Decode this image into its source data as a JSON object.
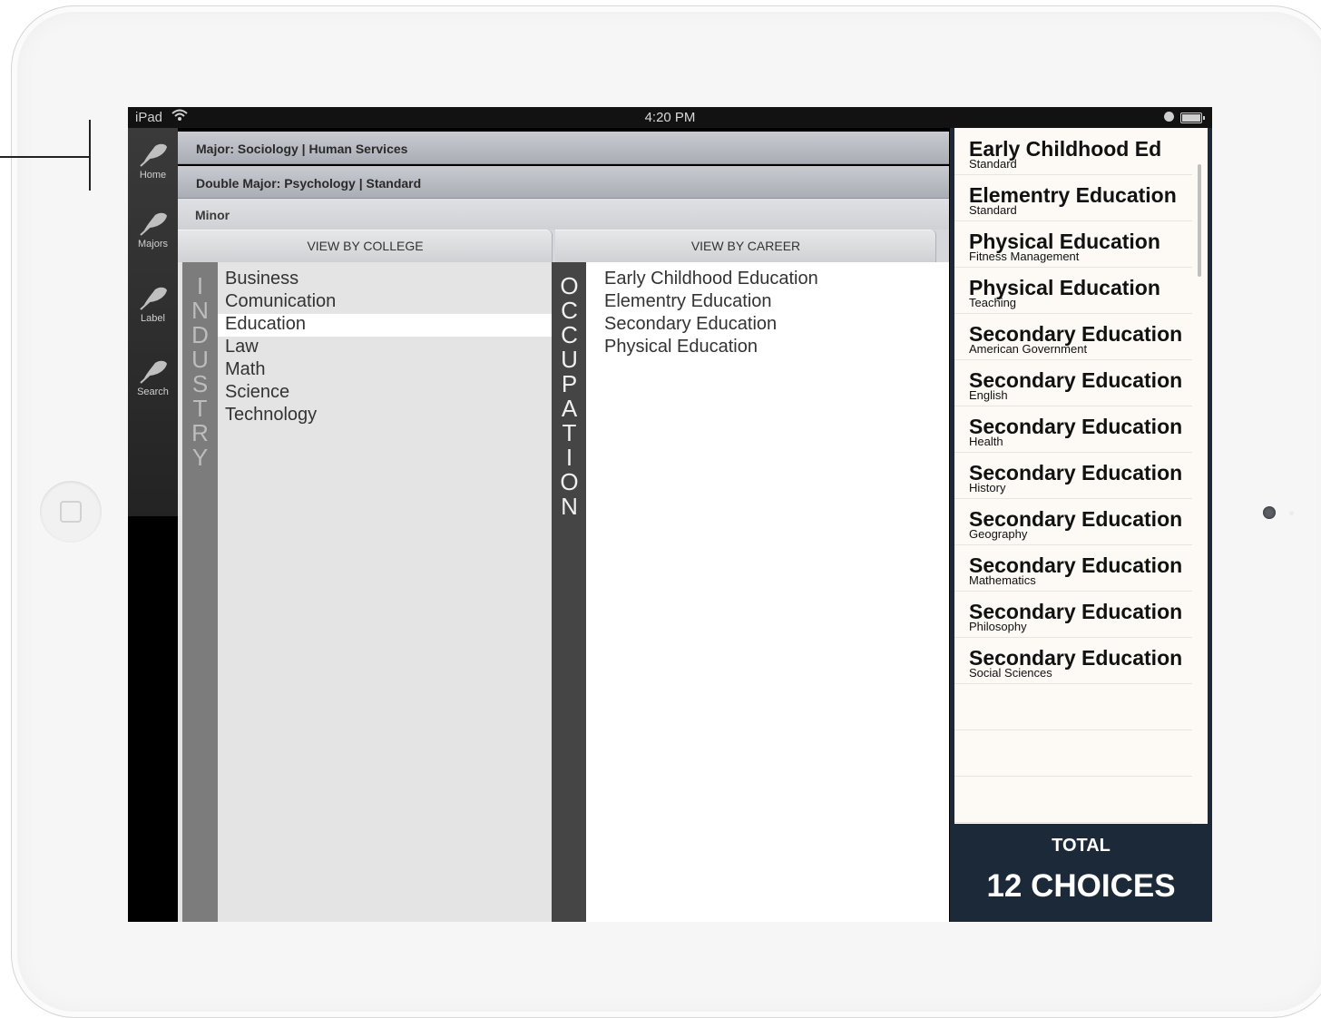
{
  "status_bar": {
    "carrier": "iPad",
    "time": "4:20 PM"
  },
  "sidebar": {
    "items": [
      {
        "label": "Home",
        "icon": "leaf-icon"
      },
      {
        "label": "Majors",
        "icon": "leaf-icon"
      },
      {
        "label": "Label",
        "icon": "leaf-icon"
      },
      {
        "label": "Search",
        "icon": "leaf-icon"
      }
    ]
  },
  "selections": {
    "major": "Major: Sociology | Human Services",
    "double_major": "Double Major: Psychology | Standard",
    "minor": "Minor"
  },
  "tabs": {
    "college": "VIEW BY COLLEGE",
    "career": "VIEW BY CAREER"
  },
  "industry": {
    "title_letters": [
      "I",
      "N",
      "D",
      "U",
      "S",
      "T",
      "R",
      "Y"
    ],
    "items": [
      "Business",
      "Comunication",
      "Education",
      "Law",
      "Math",
      "Science",
      "Technology"
    ],
    "selected": "Education"
  },
  "occupation": {
    "title_letters": [
      "O",
      "C",
      "C",
      "U",
      "P",
      "A",
      "T",
      "I",
      "O",
      "N"
    ],
    "items": [
      "Early Childhood Education",
      "Elementry Education",
      "Secondary Education",
      "Physical Education"
    ]
  },
  "choices": {
    "items": [
      {
        "title": "Early Childhood Ed",
        "subtitle": "Standard"
      },
      {
        "title": "Elementry Education",
        "subtitle": "Standard"
      },
      {
        "title": "Physical Education",
        "subtitle": "Fitness Management"
      },
      {
        "title": "Physical Education",
        "subtitle": "Teaching"
      },
      {
        "title": "Secondary Education",
        "subtitle": "American Government"
      },
      {
        "title": "Secondary Education",
        "subtitle": "English"
      },
      {
        "title": "Secondary Education",
        "subtitle": "Health"
      },
      {
        "title": "Secondary Education",
        "subtitle": "History"
      },
      {
        "title": "Secondary Education",
        "subtitle": "Geography"
      },
      {
        "title": "Secondary Education",
        "subtitle": "Mathematics"
      },
      {
        "title": "Secondary Education",
        "subtitle": "Philosophy"
      },
      {
        "title": "Secondary Education",
        "subtitle": "Social Sciences"
      }
    ],
    "total_label": "TOTAL",
    "total_value": "12 CHOICES"
  },
  "colors": {
    "choices_panel": "#1c2939",
    "occupation_bar": "#454545",
    "industry_bar": "#7c7c7c"
  }
}
